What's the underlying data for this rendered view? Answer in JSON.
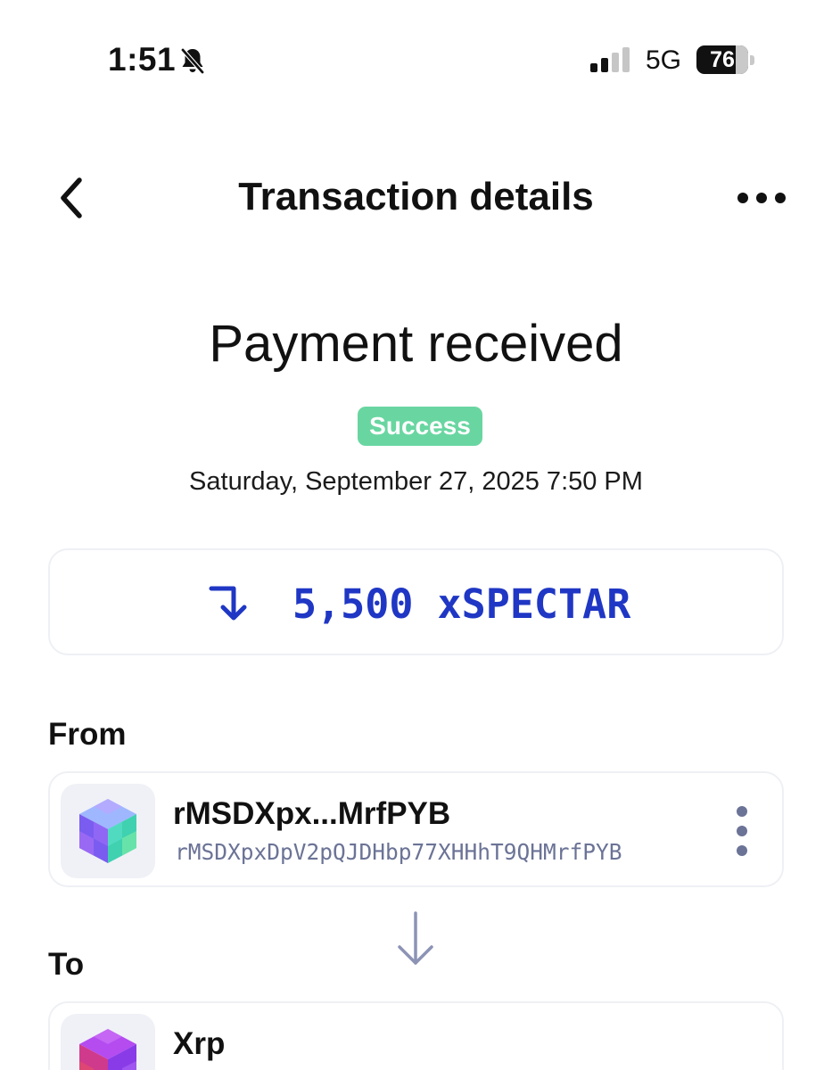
{
  "status_bar": {
    "time": "1:51",
    "network": "5G",
    "battery": "76",
    "battery_level": 0.76,
    "icons": [
      "bell-slash-icon",
      "signal-icon"
    ]
  },
  "header": {
    "title": "Transaction details",
    "back_icon": "chevron-left-icon",
    "more_icon": "more-horizontal-icon"
  },
  "transaction": {
    "heading": "Payment received",
    "status": "Success",
    "date": "Saturday, September 27, 2025 7:50 PM",
    "amount": "5,500 xSPECTAR",
    "amount_icon": "arrow-turn-down-icon"
  },
  "from": {
    "label": "From",
    "name": "rMSDXpx...MrfPYB",
    "address": "rMSDXpxDpV2pQJDHbp77XHHhT9QHMrfPYB",
    "avatar_icon": "cube-avatar-icon"
  },
  "to": {
    "label": "To",
    "name": "Xrp",
    "avatar_icon": "cube-avatar-icon"
  },
  "colors": {
    "success": "#69d6a1",
    "amount": "#1f37c4",
    "address": "#6b7396",
    "card_border": "#eef0f4"
  }
}
